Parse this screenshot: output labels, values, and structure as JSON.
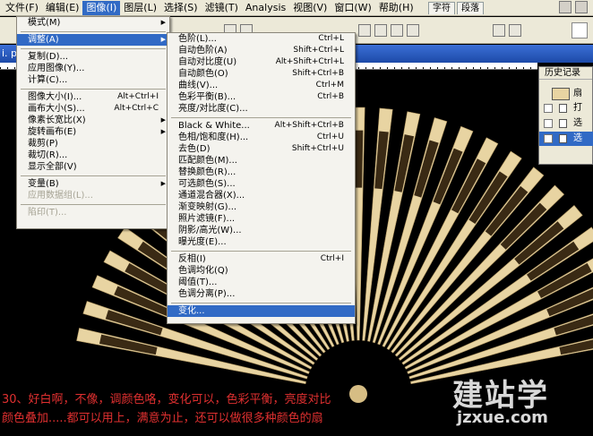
{
  "menubar": {
    "items": [
      "文件(F)",
      "编辑(E)",
      "图像(I)",
      "图层(L)",
      "选择(S)",
      "滤镜(T)",
      "Analysis",
      "视图(V)",
      "窗口(W)",
      "帮助(H)"
    ],
    "active": "图像(I)",
    "panel_tabs": [
      "字符",
      "段落"
    ]
  },
  "document": {
    "title": "i. p"
  },
  "image_menu": {
    "items": [
      {
        "label": "模式(M)",
        "submenu": true
      },
      {
        "sep": true
      },
      {
        "label": "调整(A)",
        "submenu": true,
        "selected": true
      },
      {
        "sep": true
      },
      {
        "label": "复制(D)..."
      },
      {
        "label": "应用图像(Y)..."
      },
      {
        "label": "计算(C)..."
      },
      {
        "sep": true
      },
      {
        "label": "图像大小(I)...",
        "shortcut": "Alt+Ctrl+I"
      },
      {
        "label": "画布大小(S)...",
        "shortcut": "Alt+Ctrl+C"
      },
      {
        "label": "像素长宽比(X)",
        "submenu": true
      },
      {
        "label": "旋转画布(E)",
        "submenu": true
      },
      {
        "label": "裁剪(P)"
      },
      {
        "label": "裁切(R)..."
      },
      {
        "label": "显示全部(V)"
      },
      {
        "sep": true
      },
      {
        "label": "变量(B)",
        "submenu": true
      },
      {
        "label": "应用数据组(L)...",
        "disabled": true
      },
      {
        "sep": true
      },
      {
        "label": "陷印(T)...",
        "disabled": true
      }
    ]
  },
  "adjust_menu": {
    "items": [
      {
        "label": "色阶(L)...",
        "shortcut": "Ctrl+L"
      },
      {
        "label": "自动色阶(A)",
        "shortcut": "Shift+Ctrl+L"
      },
      {
        "label": "自动对比度(U)",
        "shortcut": "Alt+Shift+Ctrl+L"
      },
      {
        "label": "自动颜色(O)",
        "shortcut": "Shift+Ctrl+B"
      },
      {
        "label": "曲线(V)...",
        "shortcut": "Ctrl+M"
      },
      {
        "label": "色彩平衡(B)...",
        "shortcut": "Ctrl+B"
      },
      {
        "label": "亮度/对比度(C)..."
      },
      {
        "sep": true
      },
      {
        "label": "Black & White...",
        "shortcut": "Alt+Shift+Ctrl+B"
      },
      {
        "label": "色相/饱和度(H)...",
        "shortcut": "Ctrl+U"
      },
      {
        "label": "去色(D)",
        "shortcut": "Shift+Ctrl+U"
      },
      {
        "label": "匹配颜色(M)..."
      },
      {
        "label": "替换颜色(R)..."
      },
      {
        "label": "可选颜色(S)..."
      },
      {
        "label": "通道混合器(X)..."
      },
      {
        "label": "渐变映射(G)..."
      },
      {
        "label": "照片滤镜(F)..."
      },
      {
        "label": "阴影/高光(W)..."
      },
      {
        "label": "曝光度(E)..."
      },
      {
        "sep": true
      },
      {
        "label": "反相(I)",
        "shortcut": "Ctrl+I"
      },
      {
        "label": "色调均化(Q)"
      },
      {
        "label": "阈值(T)..."
      },
      {
        "label": "色调分离(P)..."
      },
      {
        "sep": true
      },
      {
        "label": "变化...",
        "selected": true
      }
    ]
  },
  "history_panel": {
    "title": "历史记录",
    "rows": [
      "扇",
      "打",
      "选",
      "选"
    ],
    "selected_index": 3
  },
  "caption": {
    "line1": "30、好白啊，不像，调颜色咯，变化可以，色彩平衡，亮度对比",
    "line2": "颜色叠加.....都可以用上，满意为止，还可以做很多种颜色的扇"
  },
  "watermark": {
    "logo": "建站学",
    "url": "jzxue.com"
  },
  "colors": {
    "highlight": "#316ac5",
    "caption": "#e03030",
    "fan": "#e8d4a2"
  }
}
